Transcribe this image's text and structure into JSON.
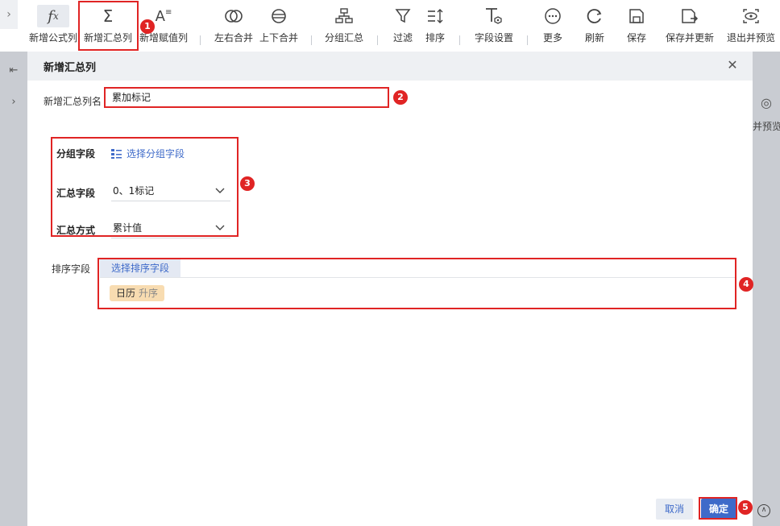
{
  "toolbar": {
    "items": [
      {
        "label": "新增公式列",
        "icon": "formula-fx-icon"
      },
      {
        "label": "新增汇总列",
        "icon": "sigma-icon"
      },
      {
        "label": "新增赋值列",
        "icon": "assign-value-icon"
      },
      {
        "label": "左右合并",
        "icon": "merge-horizontal-icon"
      },
      {
        "label": "上下合并",
        "icon": "merge-vertical-icon"
      },
      {
        "label": "分组汇总",
        "icon": "group-summary-icon"
      },
      {
        "label": "过滤",
        "icon": "filter-icon"
      },
      {
        "label": "排序",
        "icon": "sort-icon"
      },
      {
        "label": "字段设置",
        "icon": "field-settings-icon"
      },
      {
        "label": "更多",
        "icon": "more-icon"
      },
      {
        "label": "刷新",
        "icon": "refresh-icon"
      },
      {
        "label": "保存",
        "icon": "save-icon"
      },
      {
        "label": "保存并更新",
        "icon": "save-update-icon"
      },
      {
        "label": "退出并预览",
        "icon": "exit-preview-icon"
      }
    ]
  },
  "background": {
    "right_text": "并预览"
  },
  "dialog": {
    "title": "新增汇总列",
    "name_label": "新增汇总列名",
    "name_value": "累加标记",
    "group_label": "分组字段",
    "group_pick": "选择分组字段",
    "summary_field_label": "汇总字段",
    "summary_field_value": "0、1标记",
    "summary_method_label": "汇总方式",
    "summary_method_value": "累计值",
    "sort_label": "排序字段",
    "sort_pick": "选择排序字段",
    "sort_items": [
      {
        "field": "日历",
        "direction": "升序"
      }
    ],
    "cancel_label": "取消",
    "ok_label": "确定"
  },
  "annotations": [
    "1",
    "2",
    "3",
    "4",
    "5"
  ],
  "colors": {
    "accent": "#3e6ac9",
    "annotation_red": "#e02424",
    "chip": "#f8dcb1"
  }
}
